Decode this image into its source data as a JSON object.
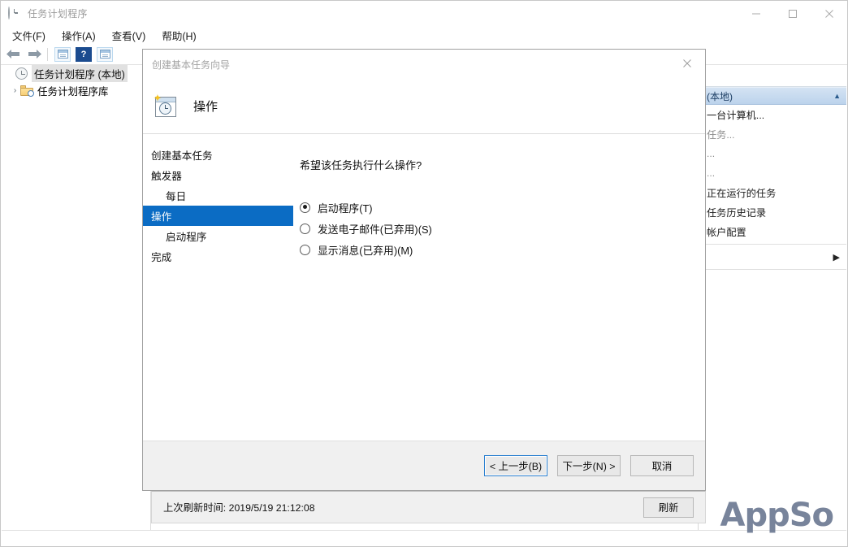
{
  "window": {
    "title": "任务计划程序",
    "title_icon": "clock-icon",
    "controls": {
      "minimize": "minimize-icon",
      "maximize": "maximize-icon",
      "close": "close-icon"
    }
  },
  "menubar": {
    "items": [
      {
        "label": "文件(F)"
      },
      {
        "label": "操作(A)"
      },
      {
        "label": "查看(V)"
      },
      {
        "label": "帮助(H)"
      }
    ]
  },
  "toolbar": {
    "items": [
      {
        "icon": "back-arrow-icon"
      },
      {
        "icon": "forward-arrow-icon"
      },
      {
        "icon": "show-hide-console-tree-icon"
      },
      {
        "icon": "help-icon",
        "label": "?"
      },
      {
        "icon": "show-hide-action-pane-icon"
      }
    ]
  },
  "tree": {
    "items": [
      {
        "label": "任务计划程序 (本地)",
        "icon": "clock-icon",
        "selected": true,
        "has_chevron": false
      },
      {
        "label": "任务计划程序库",
        "icon": "folder-task-icon",
        "selected": false,
        "has_chevron": true,
        "chevron": "›"
      }
    ]
  },
  "actions_panel": {
    "group_header": {
      "label": "(本地)",
      "collapse_icon": "chevron-up-icon"
    },
    "items": [
      {
        "label": "一台计算机...",
        "dim": false
      },
      {
        "label": "任务...",
        "dim": true
      },
      {
        "label": "...",
        "dim": true
      },
      {
        "label": "...",
        "dim": true
      },
      {
        "label": "正在运行的任务",
        "dim": false
      },
      {
        "label": "任务历史记录",
        "dim": false
      },
      {
        "label": "帐户配置",
        "dim": false
      }
    ],
    "expand_arrow": "▶"
  },
  "wizard": {
    "title": "创建基本任务向导",
    "close_icon": "close-icon",
    "header": {
      "icon": "task-wizard-icon",
      "title": "操作"
    },
    "steps": [
      {
        "label": "创建基本任务",
        "sub": false,
        "active": false
      },
      {
        "label": "触发器",
        "sub": false,
        "active": false
      },
      {
        "label": "每日",
        "sub": true,
        "active": false
      },
      {
        "label": "操作",
        "sub": false,
        "active": true
      },
      {
        "label": "启动程序",
        "sub": true,
        "active": false
      },
      {
        "label": "完成",
        "sub": false,
        "active": false
      }
    ],
    "question": "希望该任务执行什么操作?",
    "options": [
      {
        "label": "启动程序(T)",
        "checked": true
      },
      {
        "label": "发送电子邮件(已弃用)(S)",
        "checked": false
      },
      {
        "label": "显示消息(已弃用)(M)",
        "checked": false
      }
    ],
    "buttons": {
      "back": "< 上一步(B)",
      "next": "下一步(N) >",
      "cancel": "取消"
    }
  },
  "status_bar": {
    "refresh_text": "上次刷新时间: 2019/5/19 21:12:08",
    "refresh_button": "刷新"
  },
  "watermark": {
    "text": "AppSo",
    "color": "#6d7a93"
  }
}
